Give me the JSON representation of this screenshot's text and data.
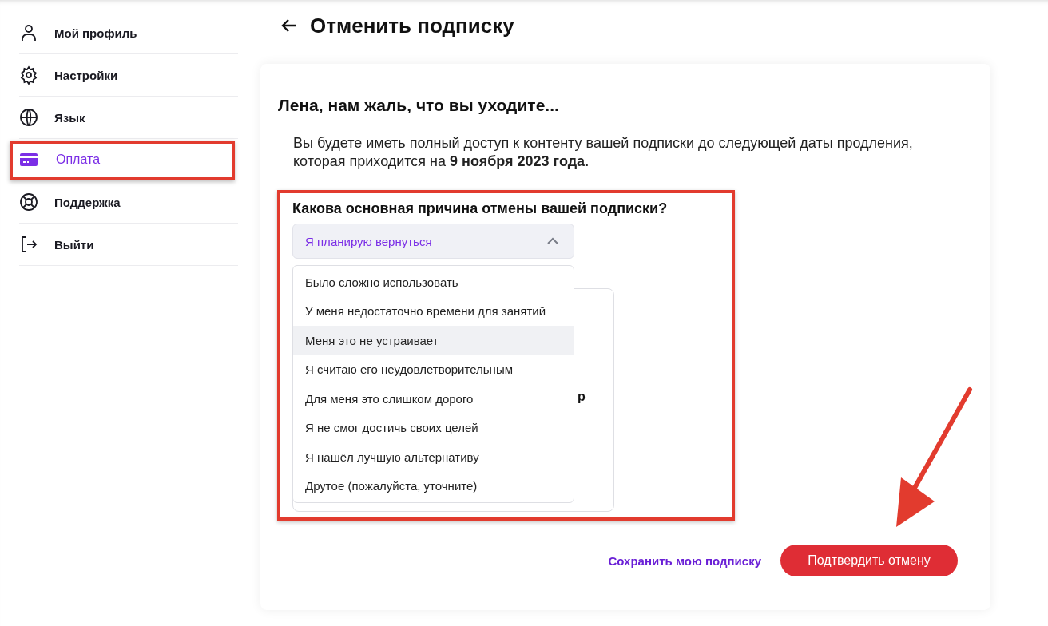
{
  "sidebar": {
    "items": [
      {
        "label": "Мой профиль",
        "kind": "user",
        "selected": false
      },
      {
        "label": "Настройки",
        "kind": "gear",
        "selected": false
      },
      {
        "label": "Язык",
        "kind": "globe",
        "selected": false
      },
      {
        "label": "Оплата",
        "kind": "card",
        "selected": true
      },
      {
        "label": "Поддержка",
        "kind": "lifebuoy",
        "selected": false
      },
      {
        "label": "Выйти",
        "kind": "logout",
        "selected": false
      }
    ]
  },
  "page": {
    "title": "Отменить подписку"
  },
  "card": {
    "heading": "Лена, нам жаль, что вы уходите...",
    "notice": "Вы будете иметь полный доступ к контенту вашей подписки до следующей даты продления, которая приходится на **9 ноября 2023 года.**",
    "question": "Какова основная причина отмены вашей подписки?",
    "select": {
      "value": "Я планирую вернуться",
      "expanded": true
    },
    "options": [
      {
        "label": "Было сложно использовать",
        "hovered": false
      },
      {
        "label": "У меня недостаточно времени для занятий",
        "hovered": false
      },
      {
        "label": "Меня это не устраивает",
        "hovered": true
      },
      {
        "label": "Я считаю его неудовлетворительным",
        "hovered": false
      },
      {
        "label": "Для меня это слишком дорого",
        "hovered": false
      },
      {
        "label": "Я не смог достичь своих целей",
        "hovered": false
      },
      {
        "label": "Я нашёл лучшую альтернативу",
        "hovered": false
      },
      {
        "label": "Друтое (пожалуйста, уточните)",
        "hovered": false
      }
    ],
    "background_card": {
      "text": "р"
    },
    "actions": {
      "keep_link": "Сохранить мою подписку",
      "confirm_button": "Подтвердить отмену"
    }
  }
}
